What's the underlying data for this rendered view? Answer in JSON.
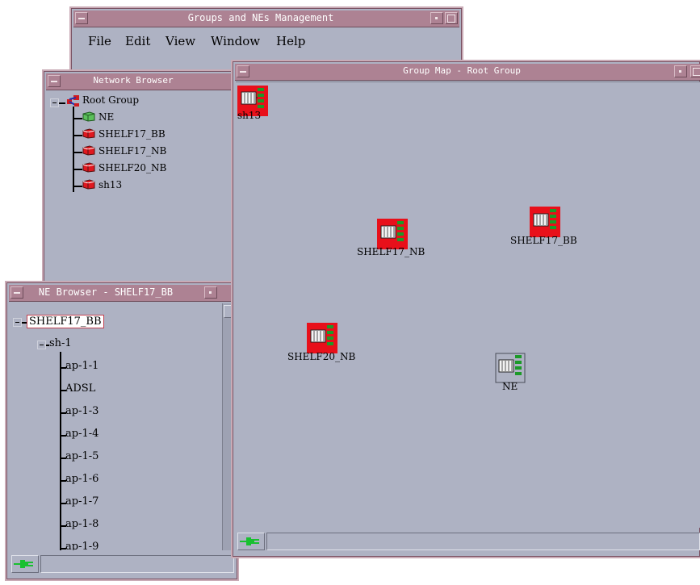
{
  "groups_window": {
    "title": "Groups and NEs Management",
    "menu": [
      "File",
      "Edit",
      "View",
      "Window",
      "Help"
    ]
  },
  "network_browser": {
    "title": "Network Browser",
    "root_label": "Root Group",
    "items": [
      {
        "label": "NE",
        "icon": "ne-green-icon"
      },
      {
        "label": "SHELF17_BB",
        "icon": "ne-red-icon"
      },
      {
        "label": "SHELF17_NB",
        "icon": "ne-red-icon"
      },
      {
        "label": "SHELF20_NB",
        "icon": "ne-red-icon"
      },
      {
        "label": "sh13",
        "icon": "ne-red-icon"
      }
    ]
  },
  "group_map": {
    "title": "Group Map - Root Group",
    "nodes": [
      {
        "label": "sh13",
        "status": "alarm"
      },
      {
        "label": "SHELF17_NB",
        "status": "alarm"
      },
      {
        "label": "SHELF17_BB",
        "status": "alarm"
      },
      {
        "label": "SHELF20_NB",
        "status": "alarm"
      },
      {
        "label": "NE",
        "status": "normal"
      }
    ]
  },
  "ne_browser": {
    "title": "NE Browser - SHELF17_BB",
    "root_label": "SHELF17_BB",
    "shelf_label": "sh-1",
    "items": [
      "ap-1-1",
      "ADSL",
      "ap-1-3",
      "ap-1-4",
      "ap-1-5",
      "ap-1-6",
      "ap-1-7",
      "ap-1-8",
      "ap-1-9"
    ]
  },
  "colors": {
    "alarm": "#e8101a",
    "normal": "#aeb2c3",
    "title_bar": "#ad8293",
    "window_bg": "#aeb2c3"
  }
}
